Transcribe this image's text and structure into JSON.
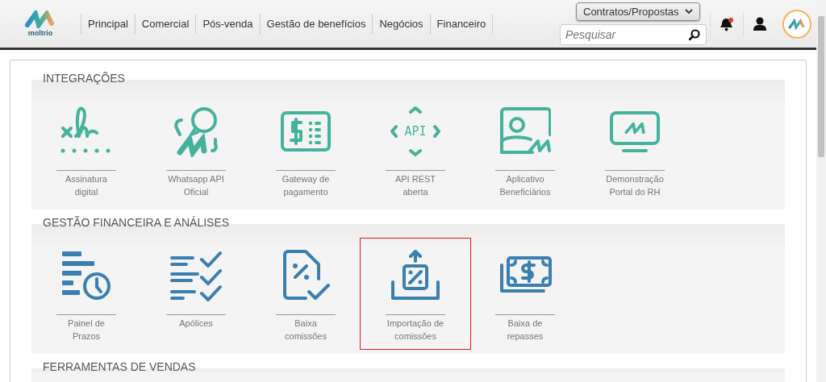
{
  "header": {
    "logo_text": "moltrio",
    "nav": [
      {
        "label": "Principal",
        "selected": false
      },
      {
        "label": "Comercial",
        "selected": false
      },
      {
        "label": "Pós-venda",
        "selected": false
      },
      {
        "label": "Gestão de benefícios",
        "selected": false
      },
      {
        "label": "Negócios",
        "selected": false
      },
      {
        "label": "Financeiro",
        "selected": false
      }
    ],
    "select": {
      "value": "Contratos/Propostas"
    },
    "search": {
      "placeholder": "Pesquisar"
    },
    "notifications": {
      "unread": true
    }
  },
  "sections": [
    {
      "title": "INTEGRAÇÕES",
      "tiles": [
        {
          "kind": "signature",
          "label": "Assinatura digital",
          "highlighted": false
        },
        {
          "kind": "whatsapp",
          "label": "Whatsapp API Oficial",
          "highlighted": false
        },
        {
          "kind": "gateway",
          "label": "Gateway de pagamento",
          "highlighted": false
        },
        {
          "kind": "api",
          "icon_text": "API",
          "label": "API REST aberta",
          "highlighted": false
        },
        {
          "kind": "person",
          "label": "Aplicativo Beneficiários",
          "highlighted": false
        },
        {
          "kind": "monitor",
          "label": "Demonstração Portal do RH",
          "highlighted": false
        }
      ]
    },
    {
      "title": "GESTÃO FINANCEIRA E ANÁLISES",
      "tiles": [
        {
          "kind": "deadline",
          "label": "Painel de Prazos",
          "highlighted": false
        },
        {
          "kind": "checklist",
          "label": "Apólices",
          "highlighted": false
        },
        {
          "kind": "document",
          "label": "Baixa comissões",
          "highlighted": false
        },
        {
          "kind": "import",
          "label": "Importação de comissões",
          "highlighted": true
        },
        {
          "kind": "money",
          "label": "Baixa de repasses",
          "highlighted": false
        }
      ]
    },
    {
      "title": "FERRAMENTAS DE VENDAS"
    }
  ]
}
